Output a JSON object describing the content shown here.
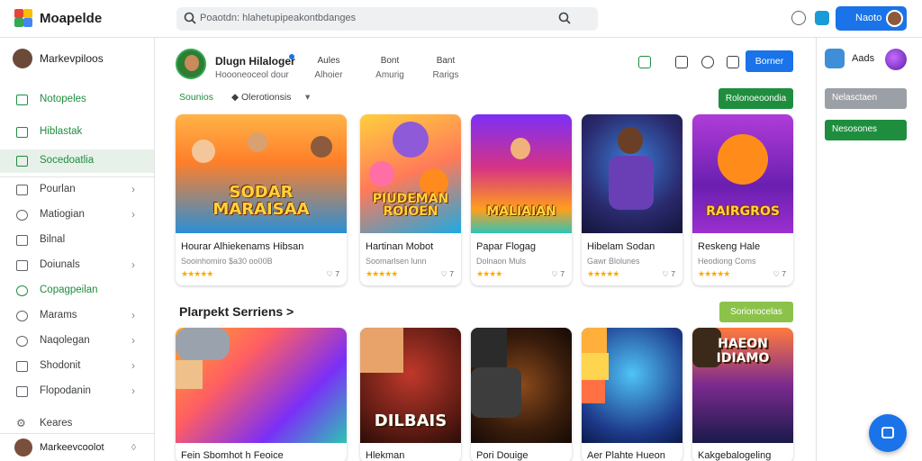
{
  "brand": {
    "name": "Moapelde"
  },
  "search": {
    "placeholder": "Poaotdn: hlahetupipeakontbdanges"
  },
  "header": {
    "signin_label": "Naoto"
  },
  "sidebar": {
    "user_name": "Markevpiloos",
    "items": [
      {
        "label": "Notopeles",
        "style": "green"
      },
      {
        "label": "Hiblastak",
        "style": "green"
      },
      {
        "label": "Socedoatlia",
        "style": "green-active"
      },
      {
        "label": "Pourlan",
        "chevron": true
      },
      {
        "label": "Matiogian",
        "chevron": true
      },
      {
        "label": "Bilnal",
        "chevron": false
      },
      {
        "label": "Doiunals",
        "chevron": true
      },
      {
        "label": "Copagpeilan",
        "style": "green"
      },
      {
        "label": "Marams",
        "chevron": true
      },
      {
        "label": "Naqolegan",
        "chevron": true
      },
      {
        "label": "Shodonit",
        "chevron": true
      },
      {
        "label": "Flopodanin",
        "chevron": true
      },
      {
        "label": "Keares",
        "chevron": false
      }
    ],
    "bottom_user": "Markeevcoolot",
    "bottom_icon": "◊"
  },
  "developer": {
    "name": "Dlugn Hilaloger",
    "subtitle": "Hoooneoceol dour",
    "stats": [
      {
        "value": "Aules",
        "label": "Alhoier"
      },
      {
        "value": "Bont",
        "label": "Amurig"
      },
      {
        "value": "Bant",
        "label": "Rarigs"
      }
    ],
    "follow_label": "Borner"
  },
  "filters": {
    "tab1": "Sounios",
    "tab2": "◆ Olerotionsis",
    "dropdown": "▾",
    "action_label": "Rolonoeoondia"
  },
  "featured_games": [
    {
      "art_text": "SODAR MARAISAA",
      "title": "Hourar Alhiekenams Hibsan",
      "meta": "Sooinhomiro $a30 oo00B",
      "stars": "★★★★★",
      "count": "♡ 7"
    },
    {
      "art_text": "PIUDEMAN ROIOEN",
      "title": "Hartinan Mobot",
      "meta": "Soomarlsen lunn",
      "stars": "★★★★★",
      "count": "♡ 7"
    },
    {
      "art_text": "MALIAIAN",
      "title": "Papar Flogag",
      "meta": "Dolnaon Muls",
      "stars": "★★★★",
      "count": "♡ 7"
    },
    {
      "art_text": "",
      "title": "Hibelam Sodan",
      "meta": "Gawr Blolunes",
      "stars": "★★★★★",
      "count": "♡ 7"
    },
    {
      "art_text": "RAIRGROS",
      "title": "Reskeng Hale",
      "meta": "Heodiong Coms",
      "stars": "★★★★★",
      "count": "♡ 7"
    }
  ],
  "section": {
    "title": "Plarpekt Serriens >",
    "action_label": "Sorionocelas"
  },
  "more_games": [
    {
      "art_text": "",
      "title": "Fein Sbomhot h Feoice"
    },
    {
      "art_text": "DILBAIS",
      "title": "Hlekman"
    },
    {
      "art_text": "",
      "title": "Pori Douige"
    },
    {
      "art_text": "",
      "title": "Aer Plahte Hueon"
    },
    {
      "art_text": "HAEON IDIAMO",
      "title": "Kakgebalogeling"
    }
  ],
  "right_panel": {
    "app_name": "Aads",
    "button1": "Nelasctaen",
    "button2": "Nesosones"
  },
  "colors": {
    "primary_blue": "#1a73e8",
    "green": "#1e8e3e",
    "lime": "#8bc34a",
    "star": "#f9ab00"
  }
}
